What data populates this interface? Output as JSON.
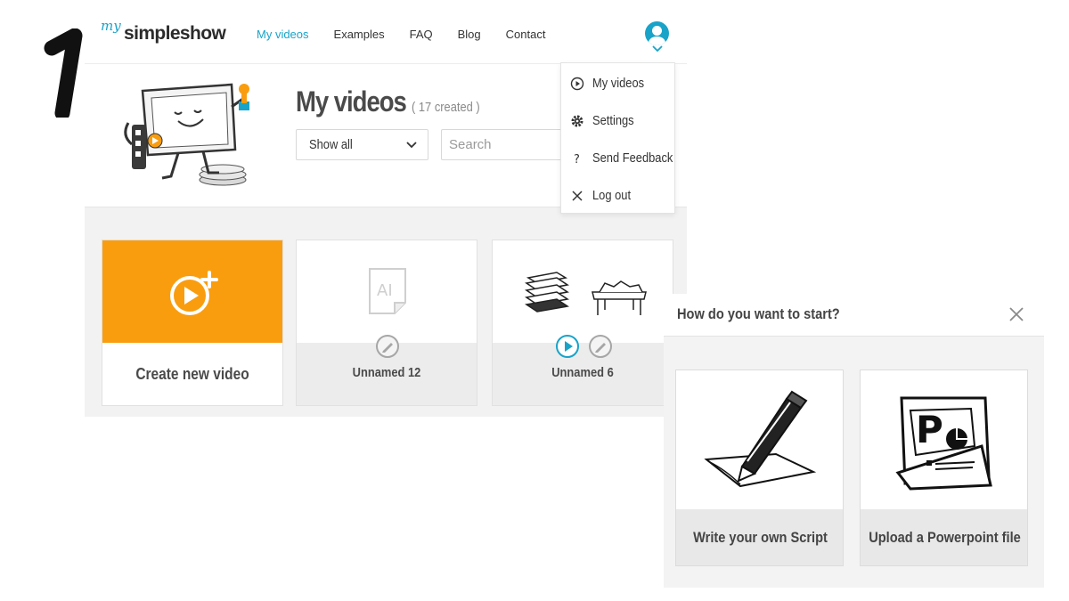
{
  "brand": {
    "logo_small": "my",
    "logo_main": "simpleshow",
    "accent": "#1aa3c8",
    "orange": "#f99d0f"
  },
  "step_number": "1",
  "nav": [
    {
      "label": "My videos",
      "active": true
    },
    {
      "label": "Examples",
      "active": false
    },
    {
      "label": "FAQ",
      "active": false
    },
    {
      "label": "Blog",
      "active": false
    },
    {
      "label": "Contact",
      "active": false
    }
  ],
  "header": {
    "avatar_icon": "user-avatar-icon"
  },
  "page": {
    "title": "My videos",
    "created_count": "( 17 created )",
    "filter_value": "Show all",
    "search_placeholder": "Search"
  },
  "cards": [
    {
      "label": "Create new video",
      "icon": "add-video-icon"
    },
    {
      "label": "Unnamed 12",
      "icon": "text-document-icon"
    },
    {
      "label": "Unnamed 6",
      "icon": "documents-table-icon"
    }
  ],
  "account_menu": [
    {
      "label": "My videos",
      "icon": "play-circle-icon"
    },
    {
      "label": "Settings",
      "icon": "gear-icon"
    },
    {
      "label": "Send Feedback",
      "icon": "question-icon"
    },
    {
      "label": "Log out",
      "icon": "close-icon"
    }
  ],
  "start_modal": {
    "title": "How do you want to start?",
    "options": [
      {
        "label": "Write your own Script",
        "icon": "pen-paper-icon"
      },
      {
        "label": "Upload a Powerpoint file",
        "icon": "powerpoint-icon"
      }
    ]
  }
}
